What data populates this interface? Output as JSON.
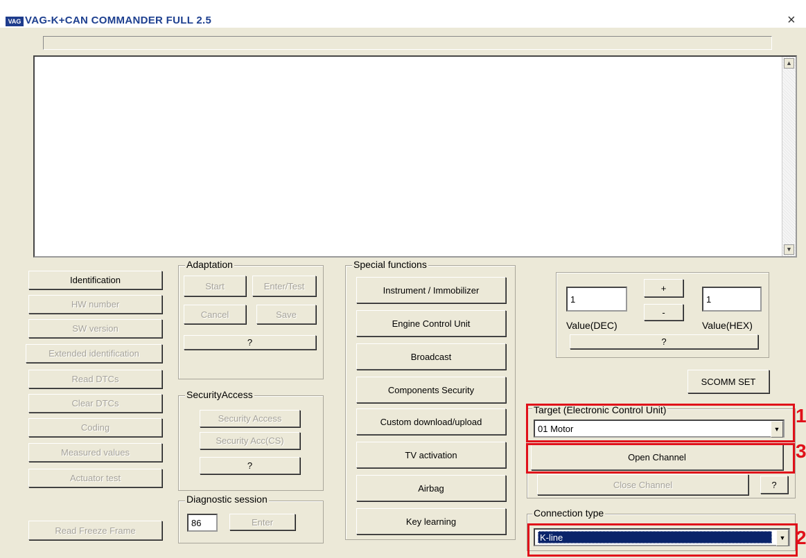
{
  "window": {
    "logo": "VAG",
    "title": "VAG-K+CAN COMMANDER FULL 2.5",
    "close": "×"
  },
  "log": {
    "scroll_up": "▲",
    "scroll_down": "▼"
  },
  "left_buttons": [
    "Identification",
    "HW number",
    "SW version",
    "Extended identification",
    "Read DTCs",
    "Clear DTCs",
    "Coding",
    "Measured values",
    "Actuator test"
  ],
  "freeze_frame": "Read Freeze Frame",
  "adaptation": {
    "label": "Adaptation",
    "start": "Start",
    "enter_test": "Enter/Test",
    "cancel": "Cancel",
    "save": "Save",
    "help": "?"
  },
  "security": {
    "label": "SecurityAccess",
    "access": "Security Access",
    "access_cs": "Security Acc(CS)",
    "help": "?"
  },
  "diag": {
    "label": "Diagnostic session",
    "value": "86",
    "enter": "Enter"
  },
  "special": {
    "label": "Special functions",
    "buttons": [
      "Instrument / Immobilizer",
      "Engine Control Unit",
      "Broadcast",
      "Components Security",
      "Custom download/upload",
      "TV activation",
      "Airbag",
      "Key learning"
    ]
  },
  "values": {
    "dec_value": "1",
    "hex_value": "1",
    "plus": "+",
    "minus": "-",
    "dec_label": "Value(DEC)",
    "hex_label": "Value(HEX)",
    "help": "?"
  },
  "scomm": "SCOMM SET",
  "target": {
    "label": "Target (Electronic Control Unit)",
    "selected": "01 Motor",
    "open": "Open Channel",
    "close": "Close Channel",
    "help": "?"
  },
  "connection": {
    "label": "Connection type",
    "selected": "K-line"
  },
  "annotations": {
    "colors": {
      "highlight": "#e0101a",
      "selection": "#0a246a"
    },
    "marks": [
      "1",
      "3",
      "2"
    ]
  }
}
